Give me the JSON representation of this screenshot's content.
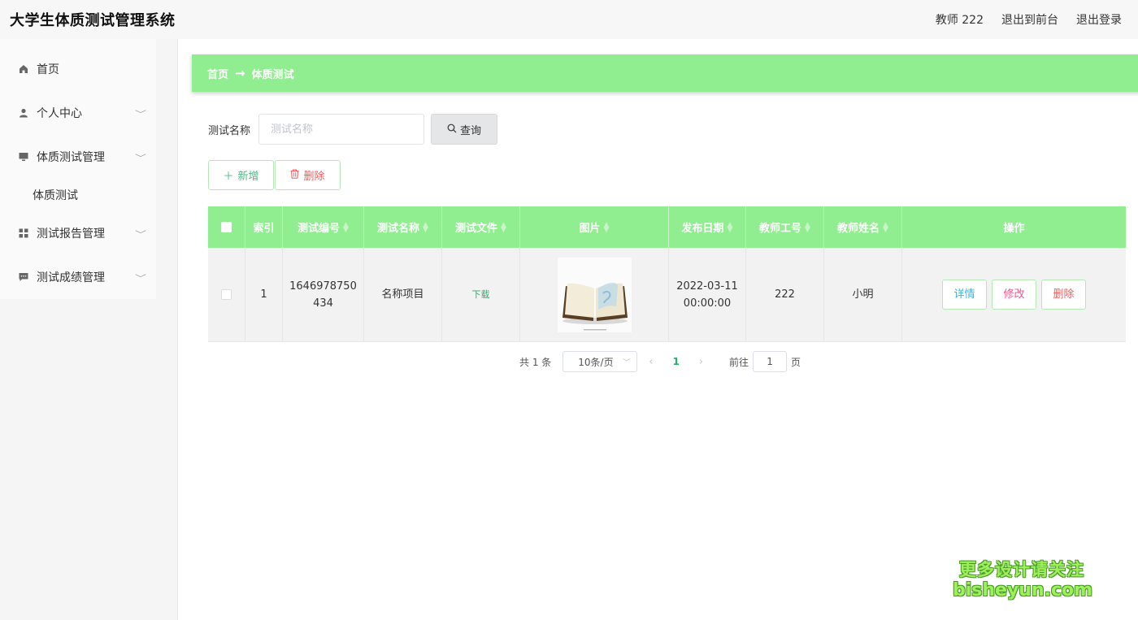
{
  "header": {
    "title": "大学生体质测试管理系统",
    "user": "教师 222",
    "to_front": "退出到前台",
    "logout": "退出登录"
  },
  "sidebar": {
    "items": [
      {
        "label": "首页",
        "icon": "home-icon"
      },
      {
        "label": "个人中心",
        "icon": "user-icon"
      },
      {
        "label": "体质测试管理",
        "icon": "monitor-icon",
        "children": [
          "体质测试"
        ]
      },
      {
        "label": "测试报告管理",
        "icon": "grid-icon"
      },
      {
        "label": "测试成绩管理",
        "icon": "chat-icon"
      }
    ]
  },
  "breadcrumb": {
    "home": "首页",
    "sep": "→",
    "current": "体质测试"
  },
  "search": {
    "label": "测试名称",
    "placeholder": "测试名称",
    "button": "查询"
  },
  "actions": {
    "add": "新增",
    "delete": "删除"
  },
  "table": {
    "headers": [
      "索引",
      "测试编号",
      "测试名称",
      "测试文件",
      "图片",
      "发布日期",
      "教师工号",
      "教师姓名",
      "操作"
    ],
    "rows": [
      {
        "index": "1",
        "code": "1646978750434",
        "name": "名称项目",
        "file": "下载",
        "date": "2022-03-11 00:00:00",
        "teacher_id": "222",
        "teacher_name": "小明",
        "ops": {
          "detail": "详情",
          "edit": "修改",
          "remove": "删除"
        }
      }
    ]
  },
  "pager": {
    "total": "共 1 条",
    "size": "10条/页",
    "current": "1",
    "goto": "前往",
    "goto_value": "1",
    "suffix": "页"
  },
  "watermark": {
    "line1": "更多设计请关注",
    "line2": "bisheyun.com"
  },
  "colors": {
    "accent": "#90ee90",
    "link": "#23b26b",
    "danger": "#f05a5a"
  }
}
